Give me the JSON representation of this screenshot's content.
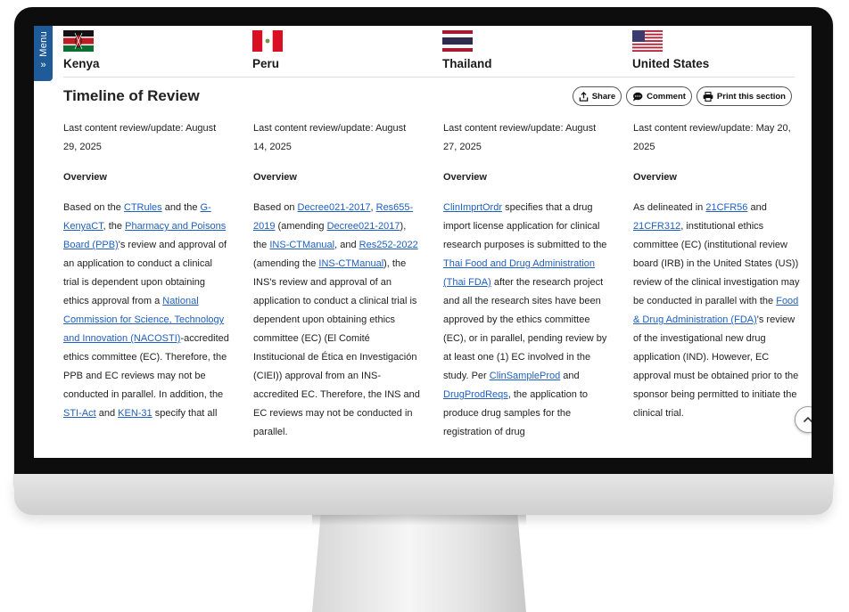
{
  "menu": {
    "label": "Menu",
    "arrows": "»"
  },
  "countries": [
    {
      "name": "Kenya"
    },
    {
      "name": "Peru"
    },
    {
      "name": "Thailand"
    },
    {
      "name": "United States"
    }
  ],
  "section": {
    "title": "Timeline of Review"
  },
  "actions": {
    "share": "Share",
    "comment": "Comment",
    "print": "Print this section"
  },
  "columns": [
    {
      "review": "Last content review/update: August 29, 2025",
      "overview_title": "Overview",
      "text": [
        "Based on the ",
        {
          "link": "CTRules"
        },
        " and the ",
        {
          "link": "G-KenyaCT"
        },
        ", the ",
        {
          "link": "Pharmacy and Poisons Board (PPB)"
        },
        "'s review and approval of an application to conduct a clinical trial is dependent upon obtaining ethics approval from a ",
        {
          "link": "National Commission for Science, Technology and Innovation (NACOSTI)"
        },
        "-accredited ethics committee (EC). Therefore, the PPB and EC reviews may not be conducted in parallel. In addition, the ",
        {
          "link": "STI-Act"
        },
        " and ",
        {
          "link": "KEN-31"
        },
        " specify that all"
      ]
    },
    {
      "review": "Last content review/update: August 14, 2025",
      "overview_title": "Overview",
      "text": [
        "Based on ",
        {
          "link": "Decree021-2017"
        },
        ", ",
        {
          "link": "Res655-2019"
        },
        " (amending ",
        {
          "link": "Decree021-2017"
        },
        "), the ",
        {
          "link": "INS-CTManual"
        },
        ", and ",
        {
          "link": "Res252-2022"
        },
        " (amending the ",
        {
          "link": "INS-CTManual"
        },
        "), the INS's review and approval of an application to conduct a clinical trial is dependent upon obtaining ethics committee (EC) (El Comité Institucional de Ética en Investigación (CIEI)) approval from an INS-accredited EC. Therefore, the INS and EC reviews may not be conducted in parallel."
      ]
    },
    {
      "review": "Last content review/update: August 27, 2025",
      "overview_title": "Overview",
      "text": [
        {
          "link": "ClinImprtOrdr"
        },
        " specifies that a drug import license application for clinical research purposes is submitted to the ",
        {
          "link": "Thai Food and Drug Administration (Thai FDA)"
        },
        " after the research project and all the research sites have been approved by the ethics committee (EC), or in parallel, pending review by at least one (1) EC involved in the study. Per ",
        {
          "link": "ClinSampleProd"
        },
        " and ",
        {
          "link": "DrugProdReqs"
        },
        ", the application to produce drug samples for the registration of drug"
      ]
    },
    {
      "review": "Last content review/update: May 20, 2025",
      "overview_title": "Overview",
      "text": [
        "As delineated in ",
        {
          "link": "21CFR56"
        },
        " and ",
        {
          "link": "21CFR312"
        },
        ", institutional ethics committee (EC) (institutional review board (IRB) in the United States (US)) review of the clinical investigation may be conducted in parallel with the ",
        {
          "link": "Food & Drug Administration (FDA)"
        },
        "'s review of the investigational new drug application (IND). However, EC approval must be obtained prior to the sponsor being permitted to initiate the clinical trial."
      ]
    }
  ],
  "colors": {
    "link": "#1f5fbf",
    "menu_tab": "#1e5b98"
  },
  "icons": {
    "share": "share-icon",
    "comment": "comment-icon",
    "print": "printer-icon",
    "scroll_top": "chevron-up-icon"
  }
}
